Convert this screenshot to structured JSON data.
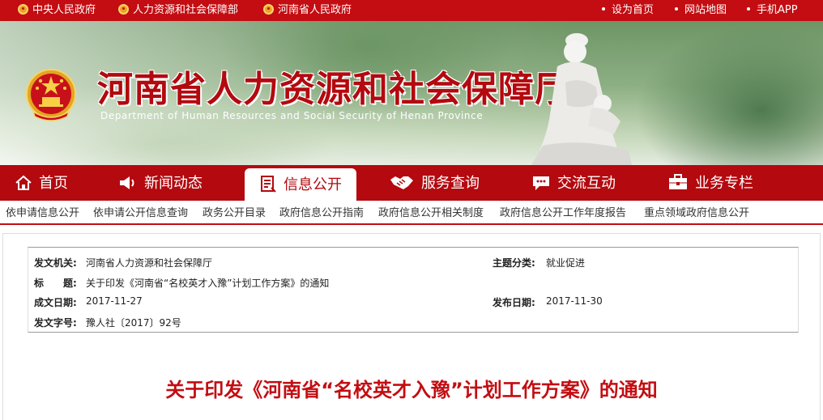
{
  "top_links": {
    "central_gov": "中央人民政府",
    "mohrss": "人力资源和社会保障部",
    "henan_gov": "河南省人民政府",
    "set_home": "设为首页",
    "sitemap": "网站地图",
    "mobile": "手机APP"
  },
  "banner": {
    "title": "河南省人力资源和社会保障厅",
    "subtitle": "Department of Human Resources and Social Security of Henan Province"
  },
  "nav": {
    "home": "首页",
    "news": "新闻动态",
    "info": "信息公开",
    "service": "服务查询",
    "interact": "交流互动",
    "topics": "业务专栏"
  },
  "subnav": [
    "依申请信息公开",
    "依申请公开信息查询",
    "政务公开目录",
    "政府信息公开指南",
    "政府信息公开相关制度",
    "政府信息公开工作年度报告",
    "重点领域政府信息公开"
  ],
  "meta": {
    "issuer_label": "发文机关:",
    "issuer": "河南省人力资源和社会保障厅",
    "topic_label": "主题分类:",
    "topic": "就业促进",
    "title_label": "标　　题:",
    "title": "关于印发《河南省“名校英才入豫”计划工作方案》的通知",
    "created_label": "成文日期:",
    "created": "2017-11-27",
    "published_label": "发布日期:",
    "published": "2017-11-30",
    "docno_label": "发文字号:",
    "docno": "豫人社〔2017〕92号"
  },
  "headline": "关于印发《河南省“名校英才入豫”计划工作方案》的通知",
  "colors": {
    "brand_red": "#c30d12",
    "nav_red": "#b3090f"
  },
  "icons": [
    "national-emblem-icon",
    "home-icon",
    "megaphone-icon",
    "document-list-icon",
    "handshake-icon",
    "chat-icon",
    "briefcase-icon"
  ]
}
